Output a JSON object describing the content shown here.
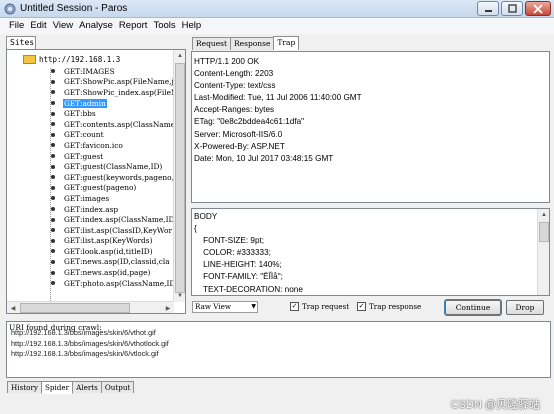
{
  "window": {
    "title": "Untitled Session - Paros"
  },
  "menu": [
    {
      "label": "File",
      "key": "F"
    },
    {
      "label": "Edit",
      "key": "E"
    },
    {
      "label": "View",
      "key": "V"
    },
    {
      "label": "Analyse",
      "key": "A"
    },
    {
      "label": "Report",
      "key": "R"
    },
    {
      "label": "Tools",
      "key": "T"
    },
    {
      "label": "Help",
      "key": "H"
    }
  ],
  "left": {
    "tab_label": "Sites",
    "root": "http://192.168.1.3",
    "items": [
      "GET:IMAGES",
      "GET:ShowPic.asp(FileName,jp",
      "GET:ShowPic_index.asp(FileN",
      "GET:admin",
      "GET:bbs",
      "GET:contents.asp(ClassName,",
      "GET:count",
      "GET:favicon.ico",
      "GET:guest",
      "GET:guest(ClassName,ID)",
      "GET:guest(keywords,pageno,s",
      "GET:guest(pageno)",
      "GET:images",
      "GET:index.asp",
      "GET:index.asp(ClassName,ID)",
      "GET:list.asp(ClassID,KeyWor",
      "GET:list.asp(KeyWords)",
      "GET:look.asp(id,titleID)",
      "GET:news.asp(ID,classid,cla",
      "GET:news.asp(id,page)",
      "GET:photo.asp(ClassName,ID)"
    ],
    "selected_index": 3
  },
  "right": {
    "tabs": [
      "Request",
      "Response",
      "Trap"
    ],
    "active_tab": "Trap",
    "header_lines": [
      "HTTP/1.1 200 OK",
      "Content-Length: 2203",
      "Content-Type: text/css",
      "Last-Modified: Tue, 11 Jul 2006 11:40:00 GMT",
      "Accept-Ranges: bytes",
      "ETag: \"0e8c2bddea4c61:1dfa\"",
      "Server: Microsoft-IIS/6.0",
      "X-Powered-By: ASP.NET",
      "Date: Mon, 10 Jul 2017 03:48:15 GMT"
    ],
    "body_lines": [
      "BODY",
      "{",
      "    FONT-SIZE: 9pt;",
      "    COLOR: #333333;",
      "    LINE-HEIGHT: 140%;",
      "    FONT-FAMILY: \"ËÎÌå\";",
      "    TEXT-DECORATION: none"
    ],
    "view_select": "Raw View",
    "trap_request_label": "Trap request",
    "trap_request_checked": true,
    "trap_response_label": "Trap response",
    "trap_response_checked": true,
    "continue_label": "Continue",
    "drop_label": "Drop"
  },
  "output": {
    "header": "URI found during crawl:",
    "lines": [
      "http://192.168.1.3/bbs/images/skin/6/vthot.gif",
      "http://192.168.1.3/bbs/images/skin/6/vthotlock.gif",
      "http://192.168.1.3/bbs/images/skin/6/vtlock.gif"
    ]
  },
  "bottom_tabs": [
    "History",
    "Spider",
    "Alerts",
    "Output"
  ],
  "bottom_active": "Spider",
  "watermark": "CSDN @贝隆驿站",
  "colors": {
    "selection": "#3399ff",
    "close_button": "#c9483a"
  }
}
